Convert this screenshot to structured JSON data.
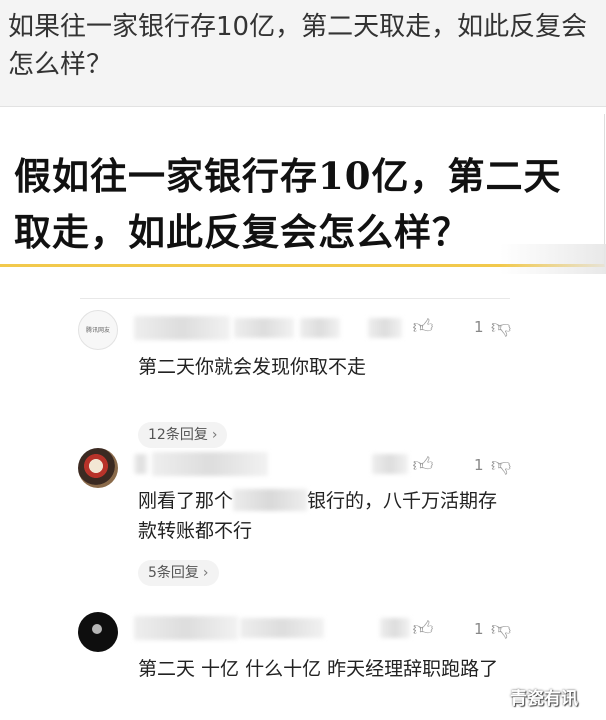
{
  "question": {
    "title": "如果往一家银行存10亿，第二天取走，如此反复会怎么样？"
  },
  "banner": {
    "text": "假如往一家银行存10亿，第二天取走，如此反复会怎么样？"
  },
  "comments": [
    {
      "avatar_text": "腾讯网友",
      "body": "第二天你就会发现你取不走",
      "like_icon": "thumb-up-icon",
      "dislike_count": "1",
      "dislike_icon": "thumb-down-icon",
      "reply_label": "12条回复"
    },
    {
      "body_before": "刚看了那个",
      "body_after": "银行的，八千万活期存款转账都不行",
      "like_icon": "thumb-up-icon",
      "dislike_count": "1",
      "dislike_icon": "thumb-down-icon",
      "reply_label": "5条回复"
    },
    {
      "body": "第二天 十亿 什么十亿 昨天经理辞职跑路了",
      "like_icon": "thumb-up-icon",
      "dislike_count": "1",
      "dislike_icon": "thumb-down-icon"
    }
  ],
  "watermark": "青瓷有讯"
}
